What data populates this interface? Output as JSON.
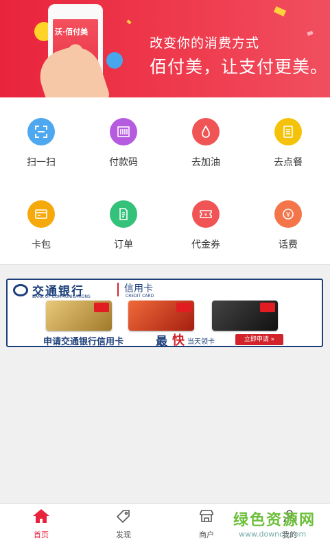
{
  "banner": {
    "line1": "改变你的消费方式",
    "line2": "佰付美，让支付更美。",
    "app_logo_text": "沃·佰付美"
  },
  "grid": [
    {
      "label": "扫一扫",
      "icon": "scan-icon",
      "color": "#4da8f0"
    },
    {
      "label": "付款码",
      "icon": "barcode-icon",
      "color": "#b45be0"
    },
    {
      "label": "去加油",
      "icon": "fuel-drop-icon",
      "color": "#f05454"
    },
    {
      "label": "去点餐",
      "icon": "menu-order-icon",
      "color": "#f5c20a"
    },
    {
      "label": "卡包",
      "icon": "card-wallet-icon",
      "color": "#f5a90a"
    },
    {
      "label": "订单",
      "icon": "order-doc-icon",
      "color": "#34c17a"
    },
    {
      "label": "代金券",
      "icon": "voucher-icon",
      "color": "#f05454"
    },
    {
      "label": "话费",
      "icon": "yuan-icon",
      "color": "#f4754a"
    }
  ],
  "ad": {
    "bank_name": "交通银行",
    "bank_name_en": "BANK OF COMMUNICATIONS",
    "credit_card": "信用卡",
    "credit_card_en": "CREDIT CARD",
    "apply_text": "申请交通银行信用卡",
    "fastest_prefix": "最",
    "fastest": "快",
    "same_day": "当天领卡",
    "apply_button": "立即申请 »"
  },
  "tabbar": [
    {
      "label": "首页",
      "icon": "home-icon",
      "active": true
    },
    {
      "label": "发现",
      "icon": "tag-icon",
      "active": false
    },
    {
      "label": "商户",
      "icon": "store-icon",
      "active": false
    },
    {
      "label": "我的",
      "icon": "user-icon",
      "active": false
    }
  ],
  "watermark": {
    "line1": "绿色资源网",
    "line2": "www.downcc.com"
  },
  "colors": {
    "brand_red": "#e8243c",
    "bank_blue": "#1c3f7a"
  }
}
